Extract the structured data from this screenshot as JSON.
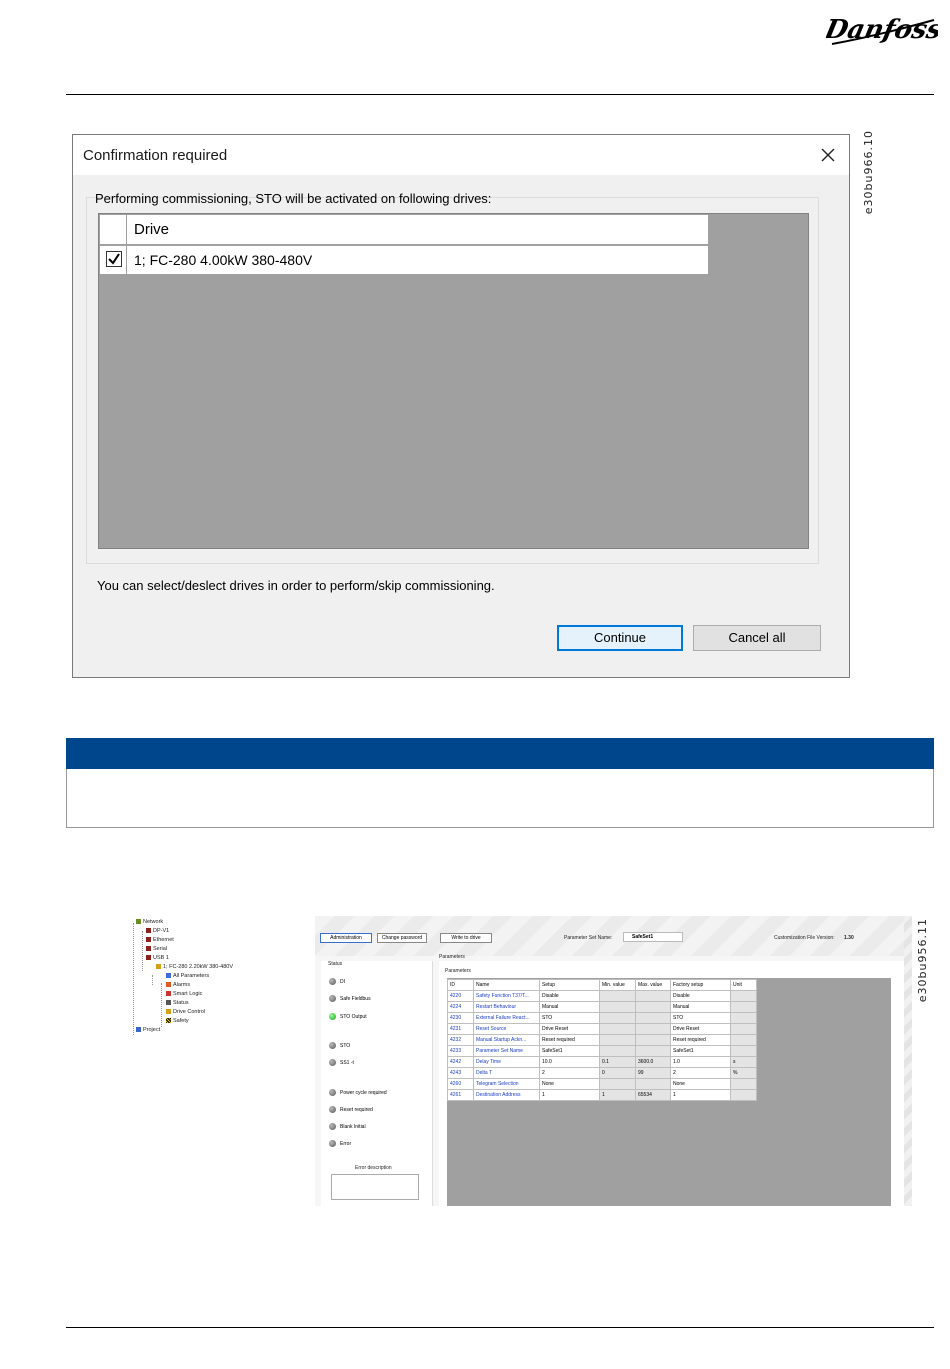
{
  "page": {
    "figure_id_1": "e30bu966.10",
    "figure_id_2": "e30bu956.11"
  },
  "brand": {
    "logo_text": "Danfoss",
    "color": "#00468c"
  },
  "dialog": {
    "title": "Confirmation required",
    "message": "Performing commissioning, STO will be activated on following drives:",
    "column_header": "Drive",
    "rows": [
      {
        "checked": true,
        "drive": "1; FC-280 4.00kW 380-480V"
      }
    ],
    "note": "You can select/deslect drives in order to perform/skip commissioning.",
    "continue_label": "Continue",
    "cancel_label": "Cancel all"
  },
  "tree": {
    "items": [
      "Network",
      "DP-V1",
      "Ethernet",
      "Serial",
      "USB 1",
      "1; FC-280 2.20kW 380-480V",
      "All Parameters",
      "Alarms",
      "Smart Logic",
      "Status",
      "Drive Control",
      "Safety",
      "Project"
    ]
  },
  "safety_screen": {
    "buttons": {
      "administration": "Administration",
      "change_password": "Change password",
      "write_to_drive": "Write to drive"
    },
    "param_set_label": "Parameter Set Name:",
    "param_set_value": "SafeSet1",
    "custom_file_label": "Customization File Version:",
    "custom_file_value": "1.30",
    "status_title": "Status",
    "parameters_tab": "Parameters",
    "parameters_group": "Parameters",
    "status_items": [
      "DI",
      "Safe Fieldbus",
      "STO Output",
      "STO",
      "SS1 -t",
      "Power cycle required",
      "Reset required",
      "Blank Initial",
      "Error"
    ],
    "error_description": "Error description",
    "table_headers": [
      "ID",
      "Name",
      "Setup",
      "Min. value",
      "Max. value",
      "Factory setup",
      "Unit"
    ],
    "table_rows": [
      [
        "4220",
        "Safety Function T37/T...",
        "Disable",
        "",
        "",
        "Disable",
        ""
      ],
      [
        "4224",
        "Restart Behaviour",
        "Manual",
        "",
        "",
        "Manual",
        ""
      ],
      [
        "4230",
        "External Failure React...",
        "STO",
        "",
        "",
        "STO",
        ""
      ],
      [
        "4231",
        "Reset Source",
        "Drive Reset",
        "",
        "",
        "Drive Reset",
        ""
      ],
      [
        "4232",
        "Manual Startup Ackn...",
        "Reset required",
        "",
        "",
        "Reset required",
        ""
      ],
      [
        "4233",
        "Parameter Set Name",
        "SafeSet1",
        "",
        "",
        "SafeSet1",
        ""
      ],
      [
        "4242",
        "Delay Time",
        "10.0",
        "0.1",
        "3600.0",
        "1.0",
        "s"
      ],
      [
        "4243",
        "Delta T",
        "2",
        "0",
        "99",
        "2",
        "%"
      ],
      [
        "4260",
        "Telegram Selection",
        "None",
        "",
        "",
        "None",
        ""
      ],
      [
        "4261",
        "Destination Address",
        "1",
        "1",
        "65534",
        "1",
        ""
      ]
    ]
  }
}
